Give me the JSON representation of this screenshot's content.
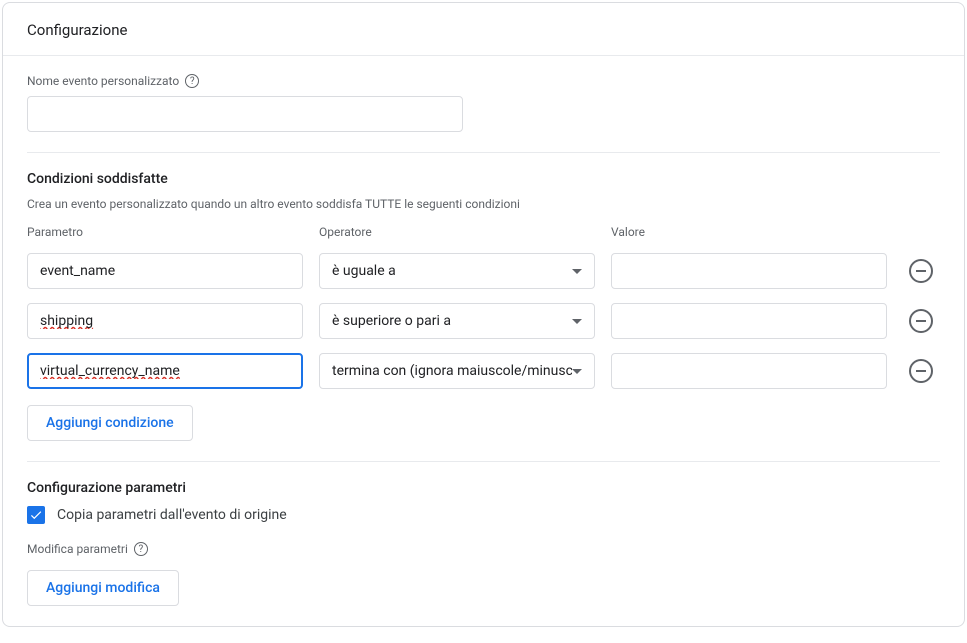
{
  "header": {
    "title": "Configurazione"
  },
  "custom_event": {
    "label": "Nome evento personalizzato",
    "value": ""
  },
  "conditions": {
    "title": "Condizioni soddisfatte",
    "subtitle": "Crea un evento personalizzato quando un altro evento soddisfa TUTTE le seguenti condizioni",
    "cols": {
      "param": "Parametro",
      "operator": "Operatore",
      "value": "Valore"
    },
    "rows": [
      {
        "param": "event_name",
        "operator": "è uguale a",
        "value": "",
        "focused": false,
        "typo": false
      },
      {
        "param": "shipping",
        "operator": "è superiore o pari a",
        "value": "",
        "focused": false,
        "typo": true
      },
      {
        "param": "virtual_currency_name",
        "operator": "termina con (ignora maiuscole/minuscole)",
        "value": "",
        "focused": true,
        "typo": true
      }
    ],
    "add_button": "Aggiungi condizione"
  },
  "params": {
    "title": "Configurazione parametri",
    "copy_label": "Copia parametri dall'evento di origine",
    "copy_checked": true,
    "modify_label": "Modifica parametri",
    "add_button": "Aggiungi modifica"
  }
}
